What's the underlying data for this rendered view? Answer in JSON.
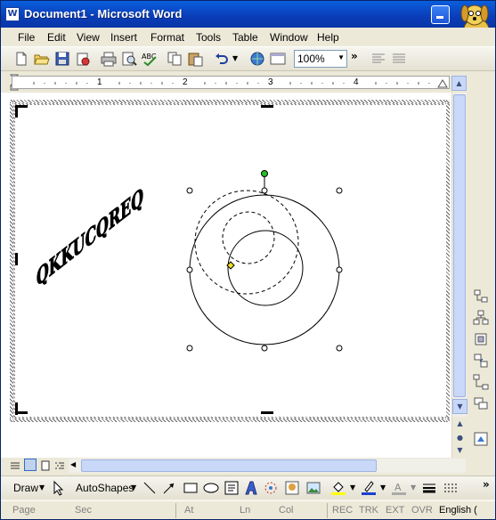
{
  "window": {
    "title": "Document1 - Microsoft Word",
    "icon_letter": "W"
  },
  "menu": [
    {
      "label": "File"
    },
    {
      "label": "Edit"
    },
    {
      "label": "View"
    },
    {
      "label": "Insert"
    },
    {
      "label": "Format"
    },
    {
      "label": "Tools"
    },
    {
      "label": "Table"
    },
    {
      "label": "Window"
    },
    {
      "label": "Help"
    }
  ],
  "toolbar": {
    "icons": [
      "new-icon",
      "open-icon",
      "save-icon",
      "permission-icon",
      "print-icon",
      "print-preview-icon",
      "spelling-icon",
      "copy-icon",
      "paste-icon",
      "undo-icon",
      "hyperlink-icon",
      "table-icon"
    ],
    "zoom": "100%",
    "more_label": "»"
  },
  "ruler": {
    "numbers": [
      "1",
      "2",
      "3",
      "4"
    ]
  },
  "drawing": {
    "wordart_text": "QKKUCQREQ",
    "shape": "venn-circles"
  },
  "drawbar": {
    "draw_label": "Draw",
    "autoshapes_label": "AutoShapes"
  },
  "status": {
    "page": "Page",
    "sec": "Sec",
    "at": "At",
    "ln": "Ln",
    "col": "Col",
    "rec": "REC",
    "trk": "TRK",
    "ext": "EXT",
    "ovr": "OVR",
    "language": "English ("
  },
  "colors": {
    "titlebar": "#0a3cb8",
    "handle_green": "#22c022",
    "handle_yellow": "#f0e020"
  }
}
